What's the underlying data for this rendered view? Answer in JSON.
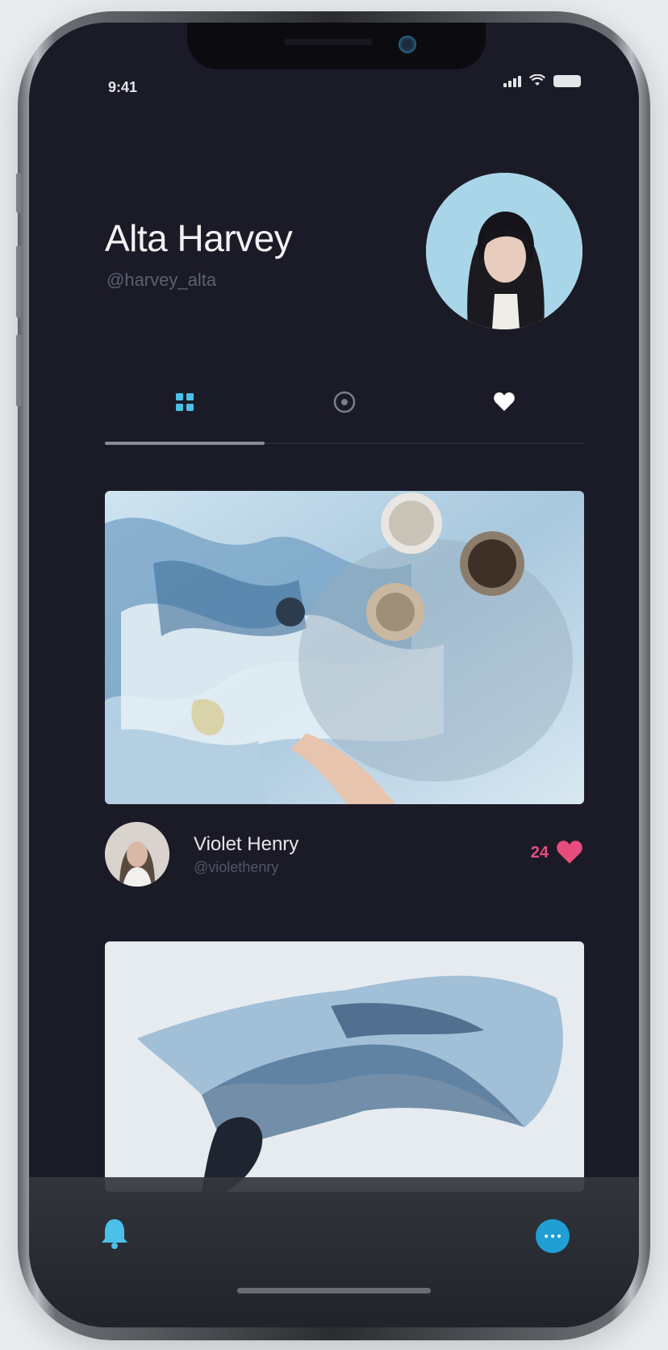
{
  "status_bar": {
    "time": "9:41"
  },
  "profile": {
    "name": "Alta Harvey",
    "handle": "@harvey_alta"
  },
  "tabs": [
    {
      "icon": "grid-icon",
      "active": true
    },
    {
      "icon": "compass-icon",
      "active": false
    },
    {
      "icon": "heart-icon",
      "active": false
    }
  ],
  "posts": [
    {
      "author_name": "Violet Henry",
      "author_handle": "@violethenry",
      "likes": "24"
    }
  ],
  "colors": {
    "background": "#1b1b27",
    "accent_pink": "#e64d7d",
    "accent_blue": "#1f9fd4",
    "tab_active": "#4cc0e8"
  },
  "bottom_nav": {
    "left_icon": "bell-icon",
    "right_icon": "chat-icon"
  }
}
